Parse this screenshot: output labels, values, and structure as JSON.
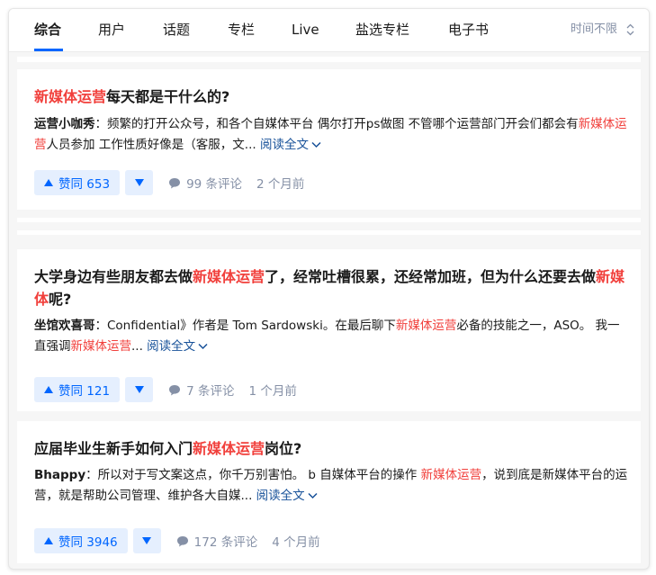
{
  "tabs": [
    {
      "label": "综合",
      "active": true
    },
    {
      "label": "用户"
    },
    {
      "label": "话题"
    },
    {
      "label": "专栏"
    },
    {
      "label": "Live"
    },
    {
      "label": "盐选专栏"
    },
    {
      "label": "电子书"
    }
  ],
  "filter": {
    "label": "时间不限"
  },
  "results": [
    {
      "title_hl": "新媒体运营",
      "title_rest": "每天都是干什么的?",
      "author": "运营小咖秀",
      "sep": "：",
      "excerpt_a": "频繁的打开公众号，和各个自媒体平台 偶尔打开ps做图 不管哪个运营部门开会们都会有",
      "excerpt_hl": "新媒体运营",
      "excerpt_b": "人员参加 工作性质好像是（客服，文...",
      "readmore": "阅读全文",
      "vote": "赞同 653",
      "comments": "99 条评论",
      "time": "2 个月前"
    },
    {
      "title_a": "大学身边有些朋友都去做",
      "title_hl1": "新媒体运营",
      "title_b": "了，经常吐槽很累，还经常加班，但为什么还要去做",
      "title_hl2": "新媒体",
      "title_c": "呢?",
      "author": "坐馆欢喜哥",
      "sep": "：",
      "excerpt_a": "Confidential》作者是 Tom Sardowski。在最后聊下",
      "excerpt_hl1": "新媒体运营",
      "excerpt_b": "必备的技能之一，ASO。 我一直强调",
      "excerpt_hl2": "新媒体运营",
      "excerpt_c": "...",
      "readmore": "阅读全文",
      "vote": "赞同 121",
      "comments": "7 条评论",
      "time": "1 个月前"
    },
    {
      "title_a": "应届毕业生新手如何入门",
      "title_hl": "新媒体运营",
      "title_b": "岗位?",
      "author": "Bhappy",
      "sep": "：",
      "excerpt_a": "所以对于写文案这点，你千万别害怕。 b 自媒体平台的操作 ",
      "excerpt_hl": "新媒体运营",
      "excerpt_b": "，说到底是新媒体平台的运营，就是帮助公司管理、维护各大自媒...",
      "readmore": "阅读全文",
      "vote": "赞同 3946",
      "comments": "172 条评论",
      "time": "4 个月前"
    }
  ],
  "colors": {
    "highlight": "#f1403c",
    "accent": "#0066ff",
    "link": "#175199",
    "muted": "#8590a6"
  }
}
